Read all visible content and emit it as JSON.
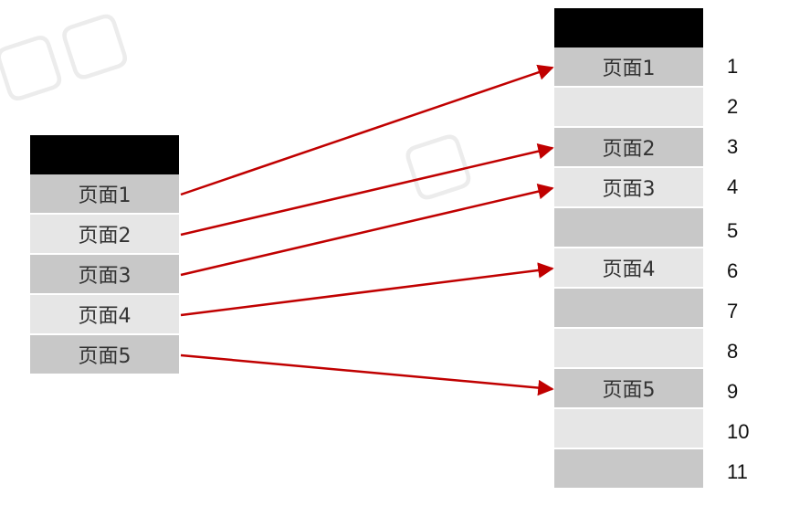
{
  "left_table": {
    "pages": [
      "页面1",
      "页面2",
      "页面3",
      "页面4",
      "页面5"
    ]
  },
  "right_table": {
    "slots": [
      {
        "index": "1",
        "label": "页面1",
        "shade": "dark"
      },
      {
        "index": "2",
        "label": "",
        "shade": "light"
      },
      {
        "index": "3",
        "label": "页面2",
        "shade": "dark"
      },
      {
        "index": "4",
        "label": "页面3",
        "shade": "light"
      },
      {
        "index": "5",
        "label": "",
        "shade": "dark"
      },
      {
        "index": "6",
        "label": "页面4",
        "shade": "light"
      },
      {
        "index": "7",
        "label": "",
        "shade": "dark"
      },
      {
        "index": "8",
        "label": "",
        "shade": "light"
      },
      {
        "index": "9",
        "label": "页面5",
        "shade": "dark"
      },
      {
        "index": "10",
        "label": "",
        "shade": "light"
      },
      {
        "index": "11",
        "label": "",
        "shade": "dark"
      }
    ]
  },
  "mappings": [
    {
      "from_page": 1,
      "to_slot": 1
    },
    {
      "from_page": 2,
      "to_slot": 3
    },
    {
      "from_page": 3,
      "to_slot": 4
    },
    {
      "from_page": 4,
      "to_slot": 6
    },
    {
      "from_page": 5,
      "to_slot": 9
    }
  ],
  "colors": {
    "arrow": "#c00000",
    "header": "#000000",
    "cell_dark": "#c8c8c8",
    "cell_light": "#e6e6e6"
  }
}
